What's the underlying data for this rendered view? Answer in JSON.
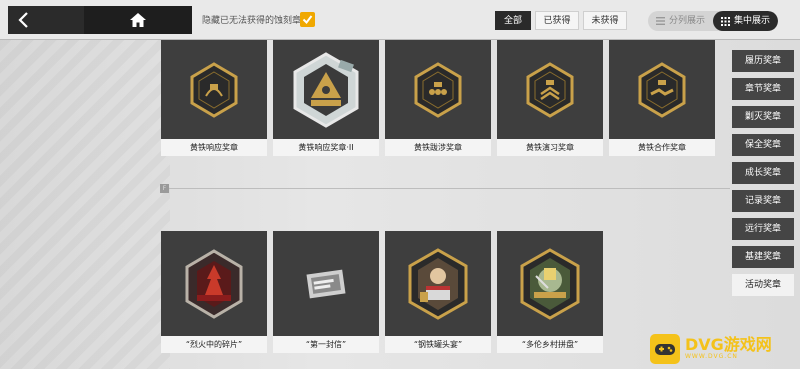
{
  "topbar": {
    "hide_label": "隐藏已无法获得的蚀刻章",
    "hide_checked": true,
    "filters": [
      {
        "label": "全部",
        "active": true
      },
      {
        "label": "已获得",
        "active": false
      },
      {
        "label": "未获得",
        "active": false
      }
    ],
    "views": [
      {
        "label": "分列展示",
        "icon": "list-icon",
        "active": false
      },
      {
        "label": "集中展示",
        "icon": "grid-icon",
        "active": true
      }
    ]
  },
  "medals_row1": [
    {
      "name": "黄铁响应奖章",
      "icon": "bronze-response-medal-icon"
    },
    {
      "name": "黄铁响应奖章·II",
      "icon": "bronze-response-medal-ii-icon"
    },
    {
      "name": "黄铁跋涉奖章",
      "icon": "bronze-trek-medal-icon"
    },
    {
      "name": "黄铁演习奖章",
      "icon": "bronze-drill-medal-icon"
    },
    {
      "name": "黄铁合作奖章",
      "icon": "bronze-cooperation-medal-icon"
    }
  ],
  "section_tag": "F",
  "medals_row2": [
    {
      "name": "“烈火中的碎片”",
      "icon": "fire-fragment-medal-icon"
    },
    {
      "name": "“第一封信”",
      "icon": "first-letter-medal-icon"
    },
    {
      "name": "“钢铁罐头宴”",
      "icon": "steel-can-feast-medal-icon"
    },
    {
      "name": "“多伦乡村拼盘”",
      "icon": "village-platter-medal-icon"
    }
  ],
  "categories": [
    {
      "label": "履历奖章",
      "active": false
    },
    {
      "label": "章节奖章",
      "active": false
    },
    {
      "label": "剿灭奖章",
      "active": false
    },
    {
      "label": "保全奖章",
      "active": false
    },
    {
      "label": "成长奖章",
      "active": false
    },
    {
      "label": "记录奖章",
      "active": false
    },
    {
      "label": "远行奖章",
      "active": false
    },
    {
      "label": "基建奖章",
      "active": false
    },
    {
      "label": "活动奖章",
      "active": true
    }
  ],
  "watermark": {
    "title": "DVG游戏网",
    "sub": "WWW.DVG.CN"
  },
  "colors": {
    "accent": "#f0a800",
    "dark": "#2b2b2b",
    "card": "#3e3e3e",
    "gold": "#c9a14a"
  }
}
